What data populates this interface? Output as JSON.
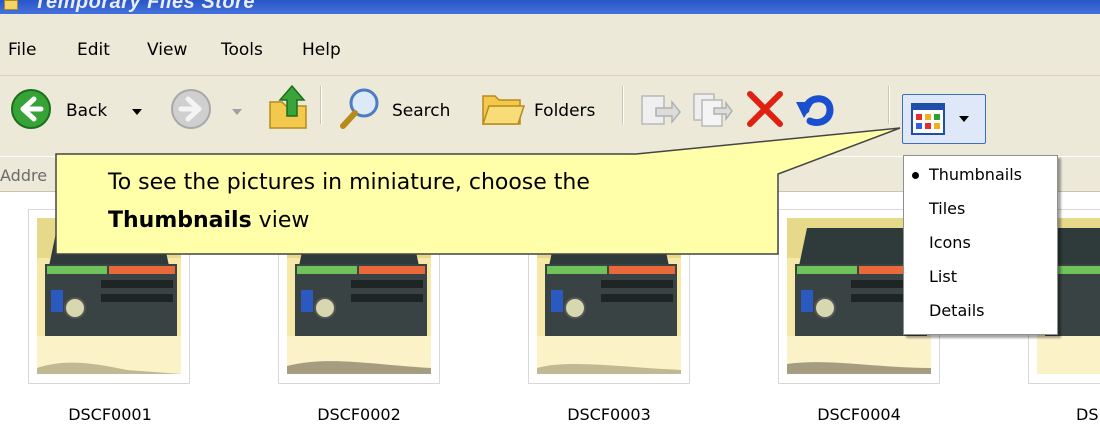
{
  "window": {
    "title": "Temporary Files Store"
  },
  "menubar": {
    "items": [
      "File",
      "Edit",
      "View",
      "Tools",
      "Help"
    ]
  },
  "toolbar": {
    "back_label": "Back",
    "search_label": "Search",
    "folders_label": "Folders",
    "icons": [
      "back-icon",
      "forward-icon",
      "up-folder-icon",
      "search-icon",
      "folders-icon",
      "move-to-icon",
      "copy-to-icon",
      "delete-icon",
      "undo-icon",
      "views-icon"
    ]
  },
  "addressbar": {
    "label": "Addre"
  },
  "callout": {
    "text_line1": "To see the pictures in miniature, choose the",
    "text_bold": "Thumbnails",
    "text_tail": " view"
  },
  "view_menu": {
    "selected": "Thumbnails",
    "options": [
      "Thumbnails",
      "Tiles",
      "Icons",
      "List",
      "Details"
    ]
  },
  "files": [
    "DSCF0001",
    "DSCF0002",
    "DSCF0003",
    "DSCF0004",
    "DS"
  ],
  "colors": {
    "callout_fill": "#ffffaa",
    "delete_red": "#e02010",
    "undo_blue": "#1a50d0",
    "back_green": "#36a336"
  }
}
